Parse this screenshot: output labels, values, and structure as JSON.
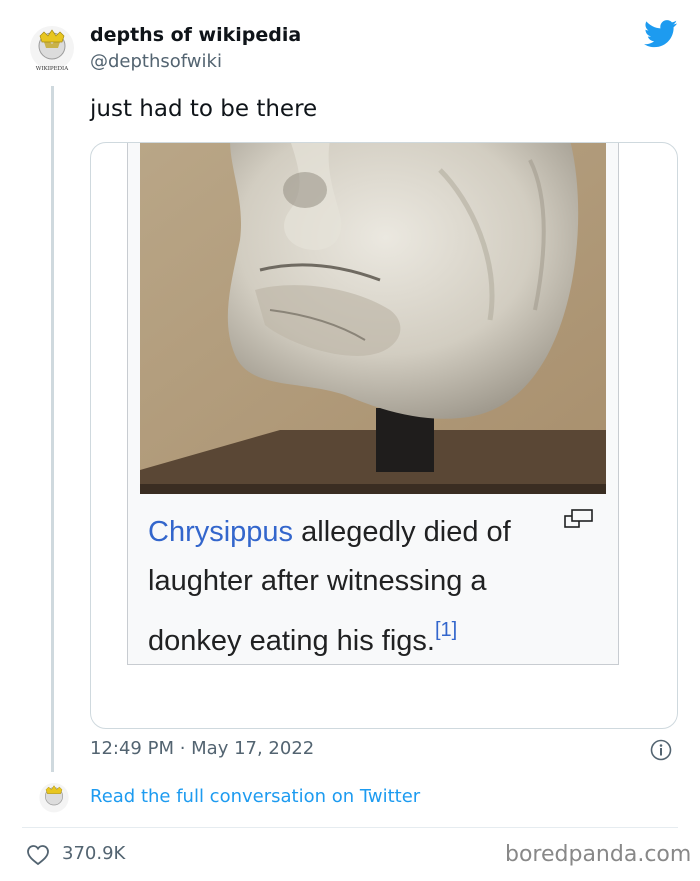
{
  "author": {
    "name": "depths of wikipedia",
    "handle": "@depthsofwiki",
    "avatar_text": "WIKIPEDIA"
  },
  "tweet": {
    "text": "just had to be there",
    "timestamp": "12:49 PM · May 17, 2022",
    "likes": "370.9K"
  },
  "media": {
    "caption_link": "Chrysippus",
    "caption_rest": " allegedly died of laughter after witnessing a donkey eating his figs.",
    "citation": "[1]"
  },
  "footer": {
    "read_more": "Read the full conversation on Twitter",
    "watermark": "boredpanda.com"
  },
  "colors": {
    "twitter_blue": "#1d9bf0",
    "text": "#0f1419",
    "secondary": "#536471",
    "wiki_link": "#3366cc"
  },
  "icons": [
    "wikipedia-globe-icon",
    "twitter-bird-icon",
    "info-icon",
    "heart-icon",
    "magnify-icon"
  ]
}
